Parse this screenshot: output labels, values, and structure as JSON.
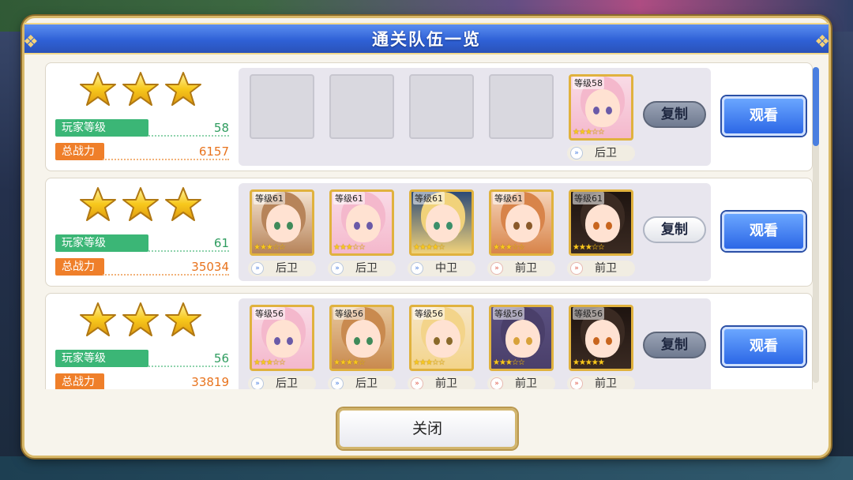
{
  "dialog": {
    "title": "通关队伍一览",
    "close_label": "关闭"
  },
  "labels": {
    "player_level": "玩家等级",
    "total_power": "总战力",
    "copy": "复制",
    "watch": "观看"
  },
  "colors": {
    "title_blue": "#2f61d6",
    "watch_button": "#2c67e6",
    "level_green": "#3bb676",
    "power_orange": "#ef7f2a",
    "frame_gold": "#e0b23e"
  },
  "teams": [
    {
      "clear_stars": 3,
      "player_level": "58",
      "total_power": "6157",
      "copy_style": "grey",
      "members": [
        {
          "empty": true
        },
        {
          "empty": true
        },
        {
          "empty": true
        },
        {
          "empty": true
        },
        {
          "level_label": "等级58",
          "rarity": 3,
          "position": "后卫",
          "hair": "#f4b8cc",
          "bg": "#f9dbe6",
          "eye": "#6a5aa8",
          "front": false
        }
      ]
    },
    {
      "clear_stars": 3,
      "player_level": "61",
      "total_power": "35034",
      "copy_style": "white",
      "members": [
        {
          "level_label": "等级61",
          "rarity": 3,
          "position": "后卫",
          "hair": "#b7845a",
          "bg": "#f3e2cf",
          "eye": "#3f8a5a",
          "front": false
        },
        {
          "level_label": "等级61",
          "rarity": 3,
          "position": "后卫",
          "hair": "#f4b8cc",
          "bg": "#f9dbe6",
          "eye": "#6a5aa8",
          "front": false
        },
        {
          "level_label": "等级61",
          "rarity": 4,
          "position": "中卫",
          "hair": "#f1d27a",
          "bg": "#2c4a77",
          "eye": "#3b8f6a",
          "front": false
        },
        {
          "level_label": "等级61",
          "rarity": 3,
          "position": "前卫",
          "hair": "#d8844a",
          "bg": "#f5d3b8",
          "eye": "#8a5a2a",
          "front": true
        },
        {
          "level_label": "等级61",
          "rarity": 3,
          "position": "前卫",
          "hair": "#3a2a22",
          "bg": "#1e1410",
          "eye": "#c8651e",
          "front": true
        }
      ]
    },
    {
      "clear_stars": 3,
      "player_level": "56",
      "total_power": "33819",
      "copy_style": "grey",
      "members": [
        {
          "level_label": "等级56",
          "rarity": 3,
          "position": "后卫",
          "hair": "#f4b8cc",
          "bg": "#f9dbe6",
          "eye": "#6a5aa8",
          "front": false
        },
        {
          "level_label": "等级56",
          "rarity": 4,
          "position": "后卫",
          "hair": "#c98a4f",
          "bg": "#e7c79c",
          "eye": "#3f8a5a",
          "front": false
        },
        {
          "level_label": "等级56",
          "rarity": 3,
          "position": "前卫",
          "hair": "#f3d48a",
          "bg": "#f6e5c6",
          "eye": "#8a6a2a",
          "front": true
        },
        {
          "level_label": "等级56",
          "rarity": 3,
          "position": "前卫",
          "hair": "#4a3f6a",
          "bg": "#5a5080",
          "eye": "#d8a23a",
          "front": true
        },
        {
          "level_label": "等级56",
          "rarity": 5,
          "position": "前卫",
          "hair": "#3a2a22",
          "bg": "#1e1410",
          "eye": "#c8651e",
          "front": true
        }
      ]
    }
  ]
}
